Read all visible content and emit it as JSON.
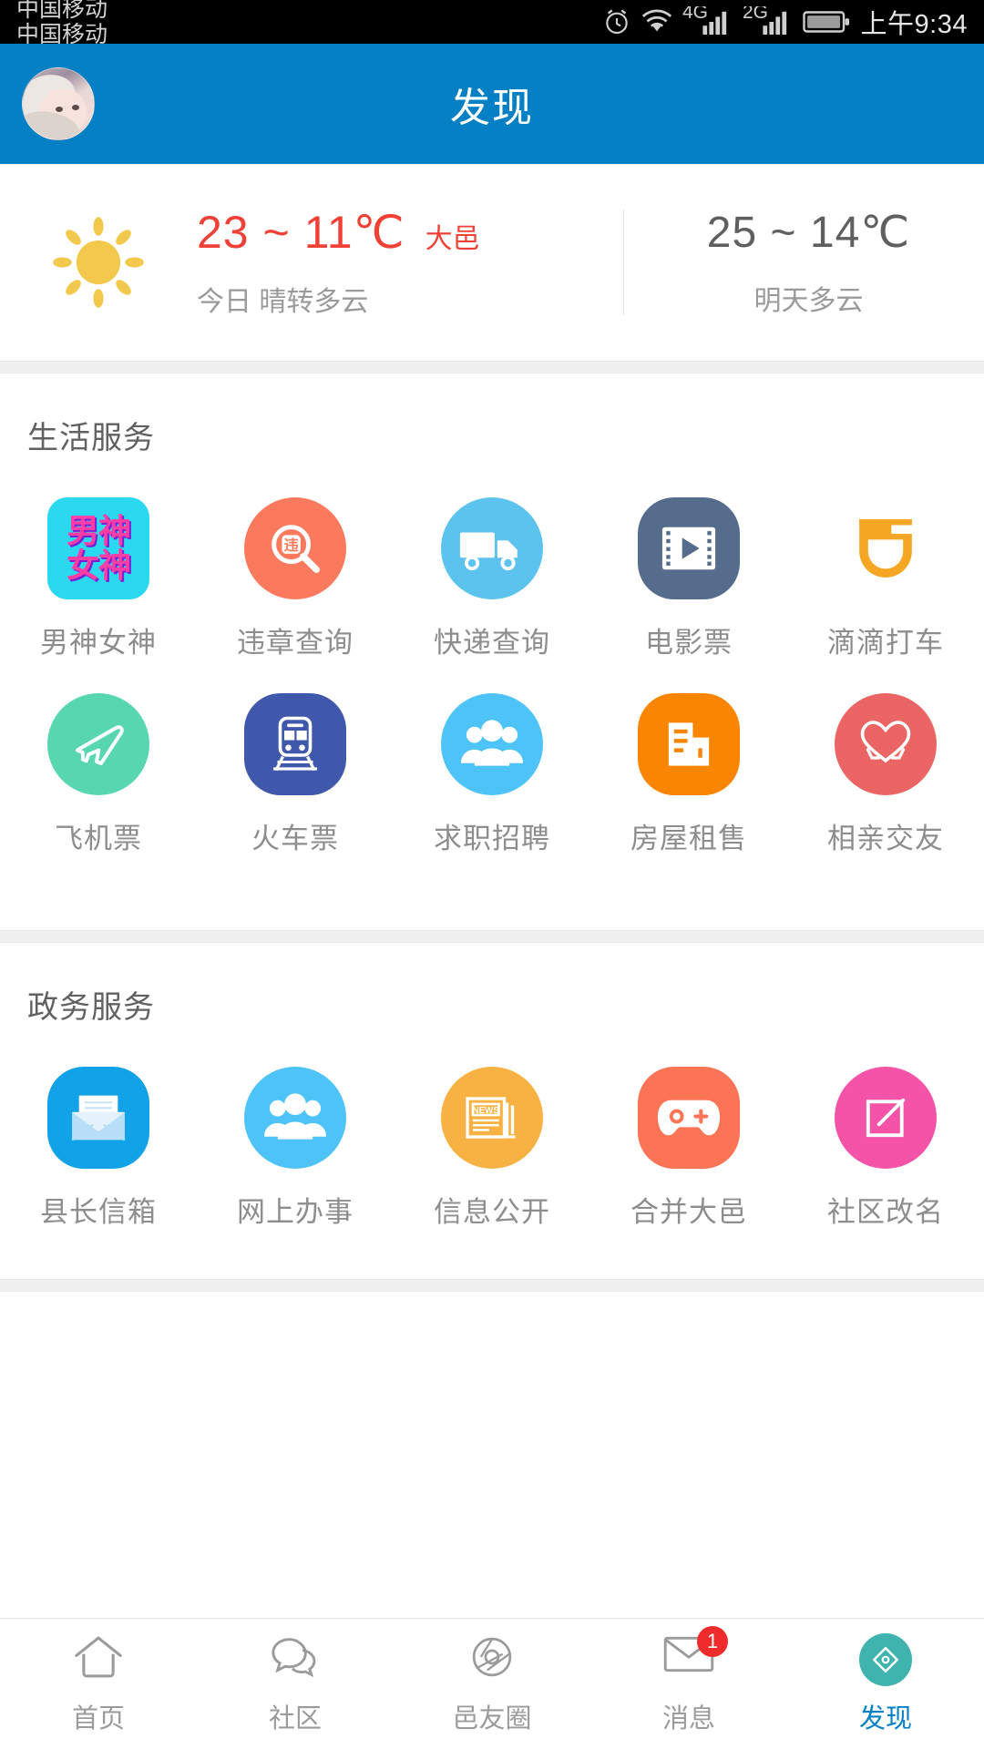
{
  "statusbar": {
    "carrier_line1": "中国移动",
    "carrier_line2": "中国移动",
    "net_label_1": "4G",
    "net_label_2": "2G",
    "clock": "上午9:34",
    "icons": [
      "alarm-icon",
      "wifi-icon",
      "signal-4g-icon",
      "signal-2g-icon",
      "battery-icon"
    ]
  },
  "header": {
    "title": "发现",
    "avatar_name": "user-avatar",
    "background_color": "#0680c4"
  },
  "weather": {
    "icon": "sun-icon",
    "today_temp": "23 ~ 11℃",
    "city": "大邑",
    "today_desc": "今日 晴转多云",
    "tomorrow_temp": "25 ~ 14℃",
    "tomorrow_desc": "明天多云",
    "temp_color": "#ef4136",
    "tomorrow_color": "#5f5f5f"
  },
  "sections": [
    {
      "title": "生活服务",
      "items": [
        {
          "label": "男神女神",
          "icon": "male-female-god-icon",
          "shape": "rounded-square",
          "color": "#2ad8ef",
          "text_top": "男神",
          "text_bottom": "女神"
        },
        {
          "label": "违章查询",
          "icon": "violation-search-icon",
          "shape": "circle",
          "color": "#fb7a5e"
        },
        {
          "label": "快递查询",
          "icon": "delivery-truck-icon",
          "shape": "circle",
          "color": "#5cc3ef"
        },
        {
          "label": "电影票",
          "icon": "film-strip-icon",
          "shape": "squircle",
          "color": "#556c8c"
        },
        {
          "label": "滴滴打车",
          "icon": "didi-logo-icon",
          "shape": "none",
          "color": "#f5a623"
        },
        {
          "label": "飞机票",
          "icon": "airplane-icon",
          "shape": "circle",
          "color": "#58d6b0"
        },
        {
          "label": "火车票",
          "icon": "train-icon",
          "shape": "squircle",
          "color": "#4058ab"
        },
        {
          "label": "求职招聘",
          "icon": "people-group-icon",
          "shape": "circle",
          "color": "#4ec3f7"
        },
        {
          "label": "房屋租售",
          "icon": "building-icon",
          "shape": "squircle",
          "color": "#f98500"
        },
        {
          "label": "相亲交友",
          "icon": "heart-hands-icon",
          "shape": "circle",
          "color": "#eb6565"
        }
      ]
    },
    {
      "title": "政务服务",
      "items": [
        {
          "label": "县长信箱",
          "icon": "envelope-mail-icon",
          "shape": "squircle",
          "color": "#11a2e8"
        },
        {
          "label": "网上办事",
          "icon": "people-group-icon",
          "shape": "circle",
          "color": "#4ec3f7"
        },
        {
          "label": "信息公开",
          "icon": "newspaper-icon",
          "shape": "circle",
          "color": "#f8b243"
        },
        {
          "label": "合并大邑",
          "icon": "gamepad-icon",
          "shape": "squircle",
          "color": "#fb7455"
        },
        {
          "label": "社区改名",
          "icon": "edit-square-icon",
          "shape": "circle",
          "color": "#f453a8"
        }
      ]
    }
  ],
  "tabbar": {
    "items": [
      {
        "label": "首页",
        "icon": "home-icon",
        "active": false,
        "badge": ""
      },
      {
        "label": "社区",
        "icon": "chat-bubbles-icon",
        "active": false,
        "badge": ""
      },
      {
        "label": "邑友圈",
        "icon": "aperture-icon",
        "active": false,
        "badge": ""
      },
      {
        "label": "消息",
        "icon": "envelope-icon",
        "active": false,
        "badge": "1"
      },
      {
        "label": "发现",
        "icon": "compass-diamond-icon",
        "active": true,
        "badge": ""
      }
    ],
    "active_color": "#0680c4",
    "inactive_color": "#9b9b9b",
    "badge_color": "#ef2b2b"
  }
}
